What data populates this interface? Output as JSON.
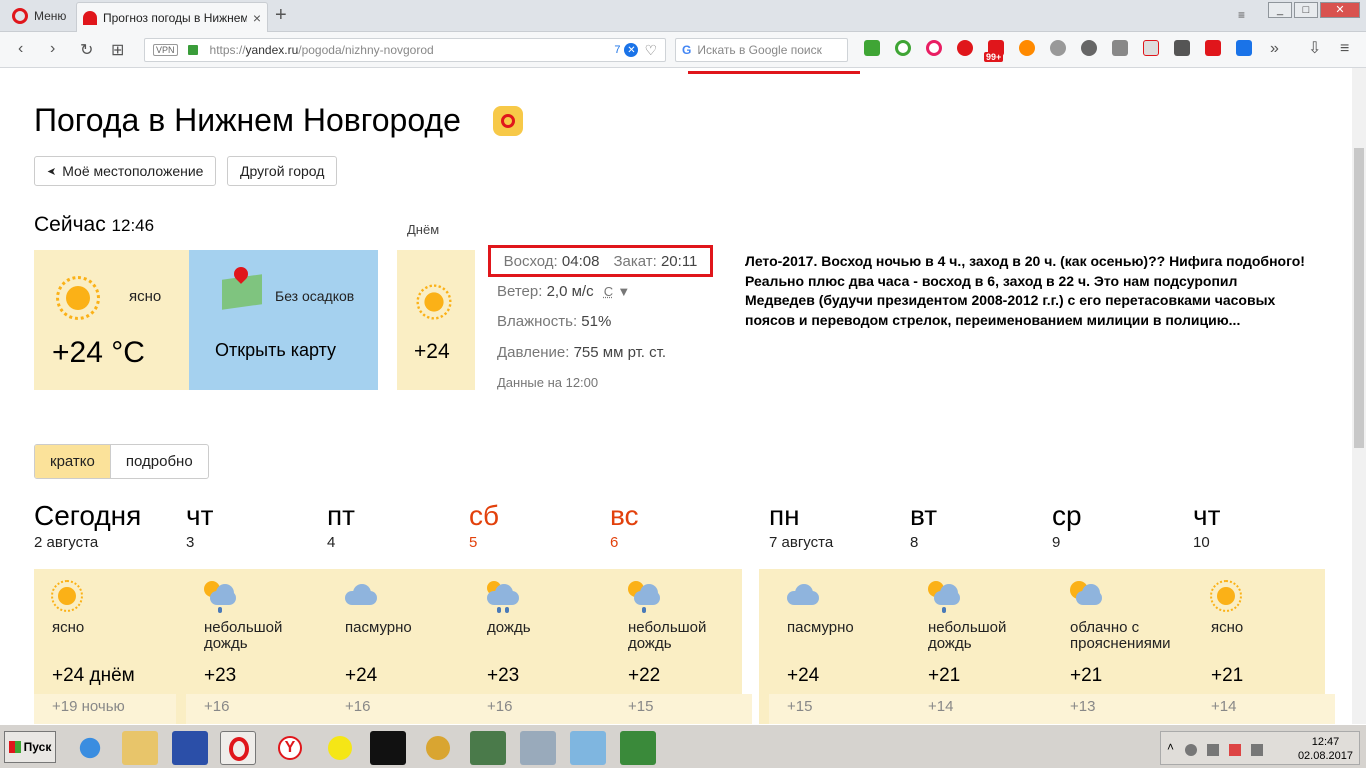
{
  "browser": {
    "menu_label": "Меню",
    "tab_title": "Прогноз погоды в Нижнем",
    "tab_close": "×",
    "newtab": "+",
    "url_prefix": "https://",
    "url_host": "yandex.ru",
    "url_path": "/pogoda/nizhny-novgorod",
    "vpn": "VPN",
    "url_badge_count": "7",
    "search_placeholder": "Искать в Google поиск",
    "ext_badge": "99+",
    "win_min": "_",
    "win_max": "□",
    "win_close": "✕",
    "nav_back": "‹",
    "nav_forward": "›",
    "nav_reload": "↻",
    "nav_speeddial": "⊞",
    "more": "»",
    "download": "⇩",
    "menu_icon": "≡"
  },
  "page": {
    "title": "Погода в Нижнем Новгороде",
    "btn_location": "Моё местоположение",
    "btn_location_icon": "➤",
    "btn_other_city": "Другой город"
  },
  "now": {
    "label": "Сейчас",
    "time": "12:46",
    "condition": "ясно",
    "temp": "+24 °C",
    "precip": "Без осадков",
    "open_map": "Открыть карту",
    "day_label": "Днём",
    "day_temp": "+24"
  },
  "details": {
    "sunrise_label": "Восход:",
    "sunrise": "04:08",
    "sunset_label": "Закат:",
    "sunset": "20:11",
    "wind_label": "Ветер:",
    "wind": "2,0 м/с",
    "wind_dir": "С",
    "wind_dir_arrow": "▼",
    "humidity_label": "Влажность:",
    "humidity": "51%",
    "pressure_label": "Давление:",
    "pressure": "755 мм рт. ст.",
    "data_time": "Данные на 12:00"
  },
  "note": "Лето-2017. Восход ночью в 4 ч., заход в 20 ч. (как осенью)?? Нифига подобного! Реально плюс два часа - восход в 6, заход в 22 ч. Это нам подсуропил Медведев (будучи президентом 2008-2012 г.г.) с его перетасовками часовых поясов и переводом стрелок, переименованием  милиции в полицию...",
  "toggle": {
    "short": "кратко",
    "detailed": "подробно"
  },
  "forecast": [
    {
      "day": "Сегодня",
      "date": "2 августа",
      "icon": "sun-icon",
      "cond": "ясно",
      "tday": "+24 днём",
      "tnight": "+19 ночью",
      "weekend": false
    },
    {
      "day": "чт",
      "date": "3",
      "icon": "light-rain-icon",
      "cond": "небольшой дождь",
      "tday": "+23",
      "tnight": "+16",
      "weekend": false
    },
    {
      "day": "пт",
      "date": "4",
      "icon": "cloud-icon",
      "cond": "пасмурно",
      "tday": "+24",
      "tnight": "+16",
      "weekend": false
    },
    {
      "day": "сб",
      "date": "5",
      "icon": "rain-icon",
      "cond": "дождь",
      "tday": "+23",
      "tnight": "+16",
      "weekend": true
    },
    {
      "day": "вс",
      "date": "6",
      "icon": "light-rain-icon",
      "cond": "небольшой дождь",
      "tday": "+22",
      "tnight": "+15",
      "weekend": true
    },
    {
      "day": "пн",
      "date": "7 августа",
      "icon": "cloud-icon",
      "cond": "пасмурно",
      "tday": "+24",
      "tnight": "+15",
      "weekend": false
    },
    {
      "day": "вт",
      "date": "8",
      "icon": "light-rain-icon",
      "cond": "небольшой дождь",
      "tday": "+21",
      "tnight": "+14",
      "weekend": false
    },
    {
      "day": "ср",
      "date": "9",
      "icon": "partly-cloudy-icon",
      "cond": "облачно с прояснениями",
      "tday": "+21",
      "tnight": "+13",
      "weekend": false
    },
    {
      "day": "чт",
      "date": "10",
      "icon": "sun-icon",
      "cond": "ясно",
      "tday": "+21",
      "tnight": "+14",
      "weekend": false
    }
  ],
  "taskbar": {
    "start": "Пуск",
    "time": "12:47",
    "date": "02.08.2017",
    "tray_arrow": "˄"
  },
  "colors": {
    "accent_red": "#e0161b",
    "card_yellow": "#faeec4",
    "map_blue": "#a5d1ef",
    "weekend": "#e2410c"
  }
}
